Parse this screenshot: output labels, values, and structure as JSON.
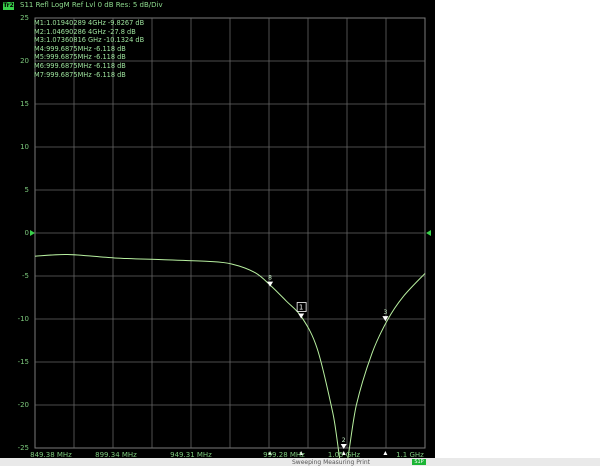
{
  "trace": {
    "tag": "Tr2",
    "header": "S11 Refl LogM Ref Lvl 0  dB Res: 5  dB/Div"
  },
  "markers": [
    {
      "text": "M1:1.01940289 4GHz -9.8267  dB"
    },
    {
      "text": "M2:1.04690286 4GHz -27.8  dB"
    },
    {
      "text": "M3:1.07360816 GHz -10.1324  dB"
    },
    {
      "text": "M4:999.6875MHz -6.118  dB"
    },
    {
      "text": "M5:999.6875MHz -6.118  dB"
    },
    {
      "text": "M6:999.6875MHz -6.118  dB"
    },
    {
      "text": "M7:999.6875MHz -6.118  dB"
    }
  ],
  "y_axis": {
    "ticks": [
      "25",
      "20",
      "15",
      "10",
      "5",
      "0",
      "-5",
      "-10",
      "-15",
      "-20",
      "-25"
    ]
  },
  "x_axis": {
    "ticks": [
      "849.38 MHz",
      "899.34 MHz",
      "949.31 MHz",
      "999.28 MHz",
      "1.05 GHz",
      "1.1 GHz"
    ]
  },
  "marker_labels": {
    "m1": "1",
    "m2": "2",
    "m3": "3",
    "m4": "8"
  },
  "status": {
    "text": "Sweeping  Measuring  Print",
    "badge": "S1P"
  },
  "colors": {
    "trace": "#b8f0a0",
    "grid": "#666666",
    "text": "#8cd98c",
    "background": "#000000"
  },
  "chart_data": {
    "type": "line",
    "x_unit": "GHz",
    "y_unit": "dB",
    "xlim": [
      0.849,
      1.099
    ],
    "ylim": [
      -25,
      25
    ],
    "series": [
      {
        "x": [
          0.849,
          0.87,
          0.9,
          0.93,
          0.96,
          0.975,
          0.99,
          1.0,
          1.01,
          1.02,
          1.03,
          1.04,
          1.047,
          1.055,
          1.065,
          1.075,
          1.085,
          1.099
        ],
        "y": [
          -2.7,
          -2.5,
          -2.9,
          -3.1,
          -3.3,
          -3.6,
          -4.6,
          -6.1,
          -7.9,
          -9.8,
          -13.5,
          -21.0,
          -27.8,
          -20.0,
          -14.0,
          -10.1,
          -7.4,
          -4.7
        ]
      }
    ]
  }
}
